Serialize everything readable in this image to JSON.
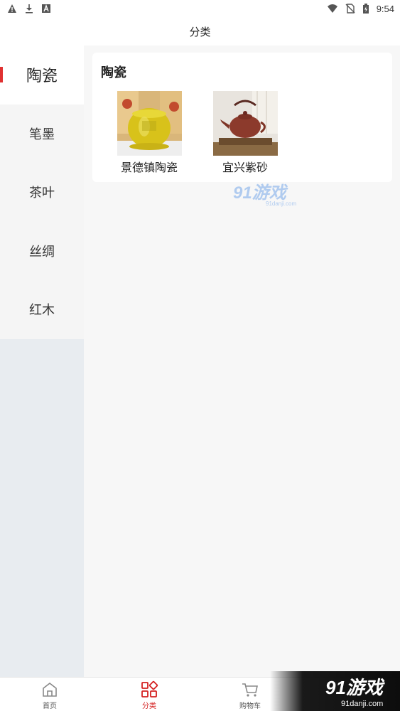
{
  "status_bar": {
    "time": "9:54",
    "left_icons": [
      "warning-icon",
      "download-icon",
      "text-a-icon"
    ],
    "right_icons": [
      "wifi-icon",
      "no-sim-icon",
      "battery-icon"
    ]
  },
  "header": {
    "title": "分类"
  },
  "sidebar": {
    "items": [
      {
        "label": "陶瓷",
        "active": true
      },
      {
        "label": "笔墨",
        "active": false
      },
      {
        "label": "茶叶",
        "active": false
      },
      {
        "label": "丝绸",
        "active": false
      },
      {
        "label": "红木",
        "active": false
      }
    ],
    "accent_color": "#e03131"
  },
  "main": {
    "section_title": "陶瓷",
    "products": [
      {
        "name": "景德镇陶瓷",
        "icon": "yellow-jar-image"
      },
      {
        "name": "宜兴紫砂",
        "icon": "teapot-image"
      }
    ]
  },
  "watermark": {
    "text": "91游戏",
    "url": "91danji.com"
  },
  "bottom_nav": {
    "items": [
      {
        "label": "首页",
        "icon": "home-icon",
        "active": false
      },
      {
        "label": "分类",
        "icon": "category-icon",
        "active": true
      },
      {
        "label": "购物车",
        "icon": "cart-icon",
        "active": false
      }
    ],
    "active_color": "#d42020"
  },
  "corner_logo": {
    "text": "91游戏",
    "url": "91danji.com"
  }
}
